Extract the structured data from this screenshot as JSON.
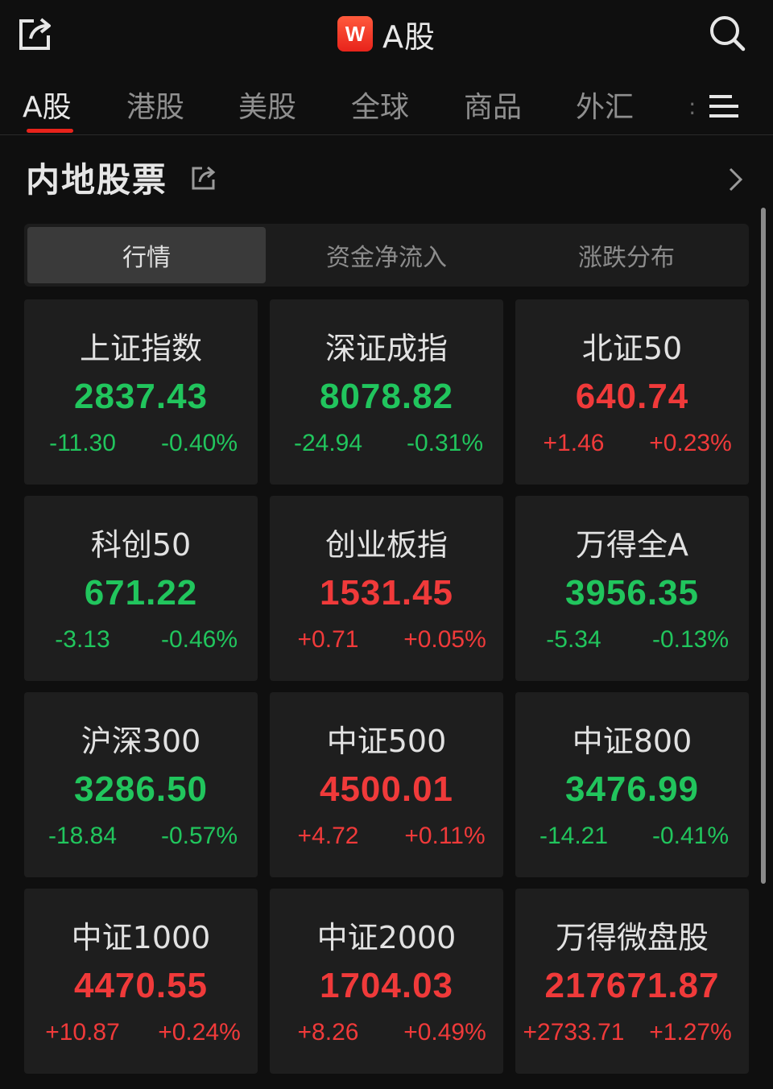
{
  "header": {
    "logo_letter": "W",
    "title": "A股"
  },
  "tabs": [
    {
      "label": "A股"
    },
    {
      "label": "港股"
    },
    {
      "label": "美股"
    },
    {
      "label": "全球"
    },
    {
      "label": "商品"
    },
    {
      "label": "外汇"
    }
  ],
  "tab_overflow": ":",
  "section": {
    "title": "内地股票"
  },
  "segments": [
    {
      "label": "行情"
    },
    {
      "label": "资金净流入"
    },
    {
      "label": "涨跌分布"
    }
  ],
  "colors": {
    "up": "#f03a3a",
    "down": "#21c55d",
    "accent": "#e8231b"
  },
  "cards": [
    {
      "name": "上证指数",
      "value": "2837.43",
      "change": "-11.30",
      "pct": "-0.40%",
      "trend": "down"
    },
    {
      "name": "深证成指",
      "value": "8078.82",
      "change": "-24.94",
      "pct": "-0.31%",
      "trend": "down"
    },
    {
      "name": "北证50",
      "value": "640.74",
      "change": "+1.46",
      "pct": "+0.23%",
      "trend": "up"
    },
    {
      "name": "科创50",
      "value": "671.22",
      "change": "-3.13",
      "pct": "-0.46%",
      "trend": "down"
    },
    {
      "name": "创业板指",
      "value": "1531.45",
      "change": "+0.71",
      "pct": "+0.05%",
      "trend": "up"
    },
    {
      "name": "万得全A",
      "value": "3956.35",
      "change": "-5.34",
      "pct": "-0.13%",
      "trend": "down"
    },
    {
      "name": "沪深300",
      "value": "3286.50",
      "change": "-18.84",
      "pct": "-0.57%",
      "trend": "down"
    },
    {
      "name": "中证500",
      "value": "4500.01",
      "change": "+4.72",
      "pct": "+0.11%",
      "trend": "up"
    },
    {
      "name": "中证800",
      "value": "3476.99",
      "change": "-14.21",
      "pct": "-0.41%",
      "trend": "down"
    },
    {
      "name": "中证1000",
      "value": "4470.55",
      "change": "+10.87",
      "pct": "+0.24%",
      "trend": "up"
    },
    {
      "name": "中证2000",
      "value": "1704.03",
      "change": "+8.26",
      "pct": "+0.49%",
      "trend": "up"
    },
    {
      "name": "万得微盘股",
      "value": "217671.87",
      "change": "+2733.71",
      "pct": "+1.27%",
      "trend": "up"
    }
  ]
}
